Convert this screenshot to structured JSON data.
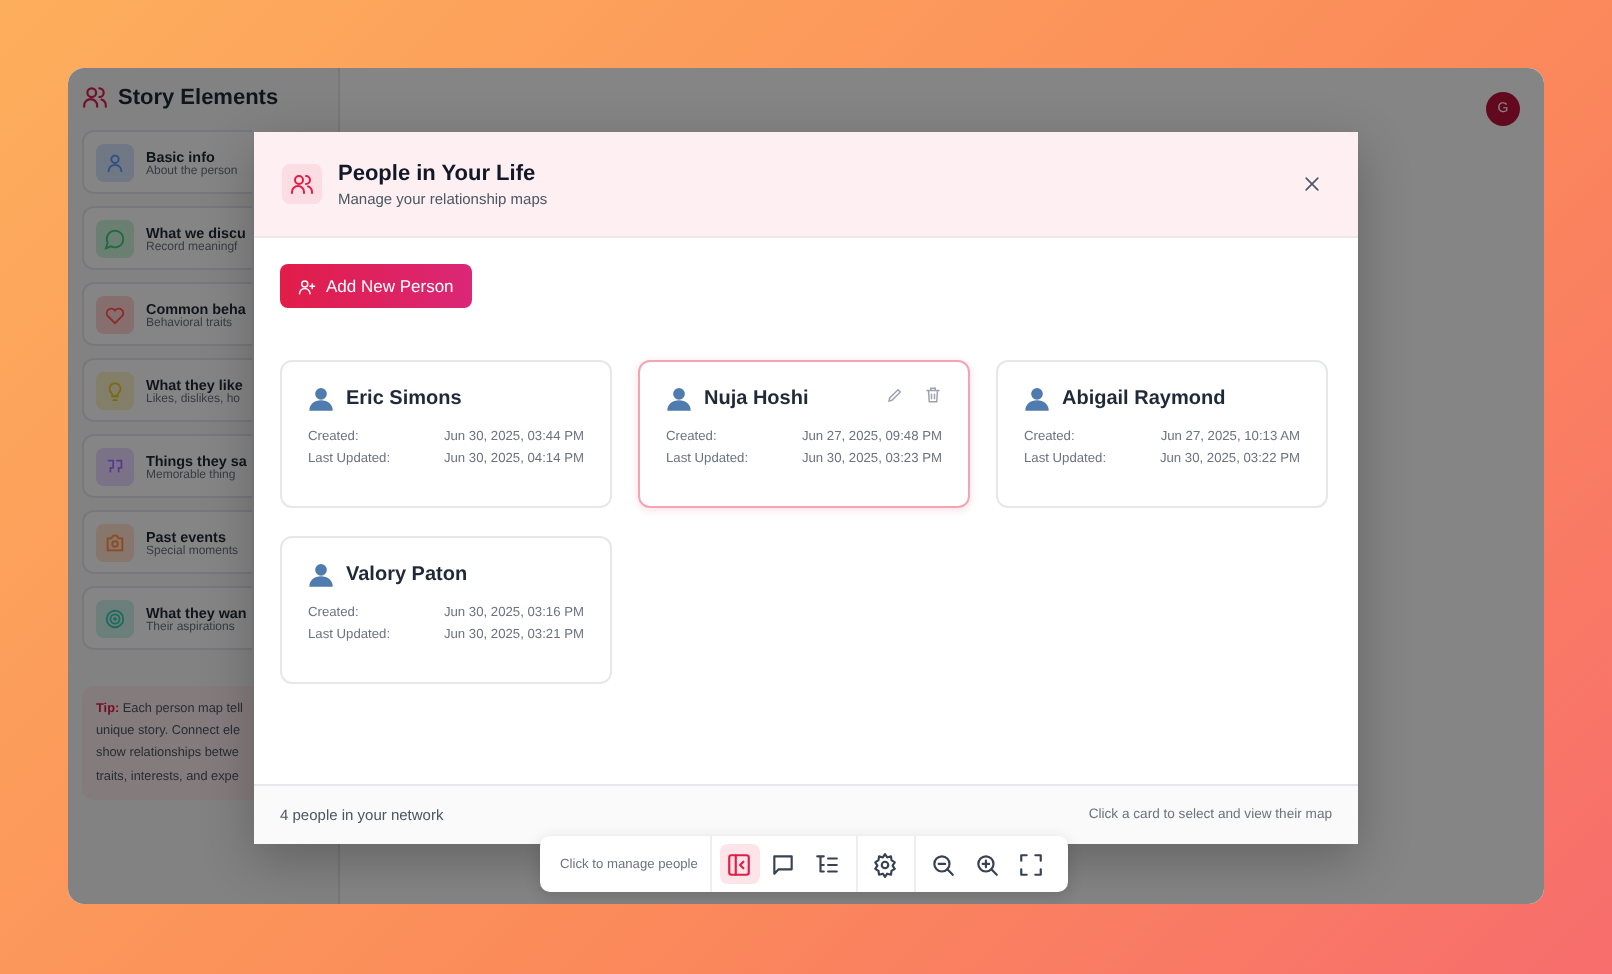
{
  "sidebar": {
    "title": "Story Elements",
    "items": [
      {
        "title": "Basic info",
        "subtitle": "About the person",
        "color": "#2f4f86"
      },
      {
        "title": "What we discu",
        "subtitle": "Record meaningf",
        "color": "#1e6b3c"
      },
      {
        "title": "Common beha",
        "subtitle": "Behavioral traits",
        "color": "#8a2c2c"
      },
      {
        "title": "What they like",
        "subtitle": "Likes, dislikes, ho",
        "color": "#7c6a14"
      },
      {
        "title": "Things they sa",
        "subtitle": "Memorable thing",
        "color": "#5b3a8e"
      },
      {
        "title": "Past events",
        "subtitle": "Special moments",
        "color": "#8c4a1e"
      },
      {
        "title": "What they wan",
        "subtitle": "Their aspirations",
        "color": "#1d6b5c"
      }
    ],
    "tip": {
      "label": "Tip:",
      "lines": [
        " Each person map tell",
        "unique story. Connect ele",
        "show relationships betwe",
        "traits, interests, and expe"
      ]
    }
  },
  "avatar": "G",
  "modal": {
    "title": "People in Your Life",
    "subtitle": "Manage your relationship maps",
    "add_button": "Add New Person",
    "people": [
      {
        "name": "Eric Simons",
        "created_label": "Created:",
        "created": "Jun 30, 2025, 03:44 PM",
        "updated_label": "Last Updated:",
        "updated": "Jun 30, 2025, 04:14 PM",
        "selected": false
      },
      {
        "name": "Nuja Hoshi",
        "created_label": "Created:",
        "created": "Jun 27, 2025, 09:48 PM",
        "updated_label": "Last Updated:",
        "updated": "Jun 30, 2025, 03:23 PM",
        "selected": true
      },
      {
        "name": "Abigail Raymond",
        "created_label": "Created:",
        "created": "Jun 27, 2025, 10:13 AM",
        "updated_label": "Last Updated:",
        "updated": "Jun 30, 2025, 03:22 PM",
        "selected": false
      },
      {
        "name": "Valory Paton",
        "created_label": "Created:",
        "created": "Jun 30, 2025, 03:16 PM",
        "updated_label": "Last Updated:",
        "updated": "Jun 30, 2025, 03:21 PM",
        "selected": false
      }
    ],
    "footer_count": "4 people in your network",
    "footer_hint": "Click a card to select and view their map"
  },
  "toolbar": {
    "hint": "Click to manage people",
    "tools": [
      {
        "kind": "sidebar",
        "selected": true
      },
      {
        "kind": "chat",
        "selected": false
      },
      {
        "kind": "list",
        "selected": false
      },
      {
        "kind": "settings",
        "selected": false
      },
      {
        "kind": "zoom-out",
        "selected": false
      },
      {
        "kind": "zoom-in",
        "selected": false
      },
      {
        "kind": "fullscreen",
        "selected": false
      }
    ]
  }
}
